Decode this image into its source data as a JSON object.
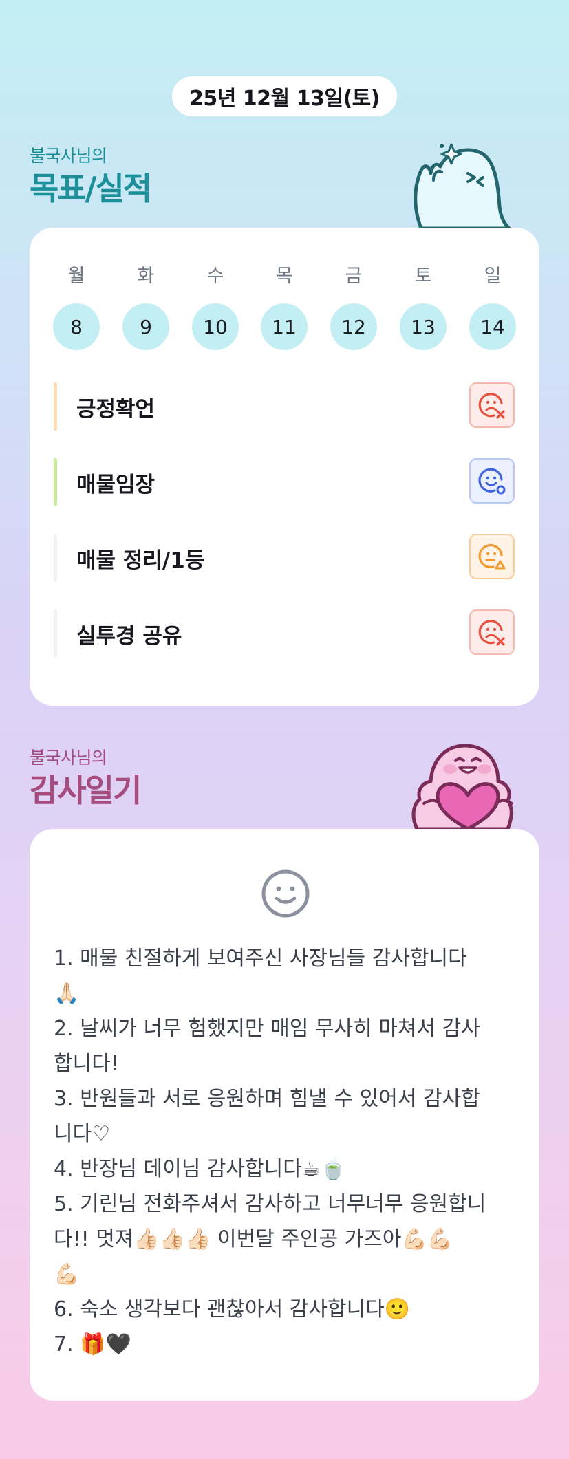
{
  "date": "25년 12월 13일(토)",
  "goals_section": {
    "subtitle": "불국사님의",
    "title": "목표/실적",
    "days": [
      {
        "name": "월",
        "date": "8"
      },
      {
        "name": "화",
        "date": "9"
      },
      {
        "name": "수",
        "date": "10"
      },
      {
        "name": "목",
        "date": "11"
      },
      {
        "name": "금",
        "date": "12"
      },
      {
        "name": "토",
        "date": "13"
      },
      {
        "name": "일",
        "date": "14"
      }
    ],
    "goals": [
      {
        "label": "긍정확언",
        "bar_color": "#f8dcae",
        "status": "sad-x-icon",
        "status_color": "#e8513f"
      },
      {
        "label": "매물임장",
        "bar_color": "#c7ec9a",
        "status": "smile-icon",
        "status_color": "#3e63dd"
      },
      {
        "label": "매물 정리/1등",
        "bar_color": "#f2f2f4",
        "status": "meh-warning-icon",
        "status_color": "#f39a2c"
      },
      {
        "label": "실투경 공유",
        "bar_color": "#f2f2f4",
        "status": "sad-x-icon",
        "status_color": "#e8513f"
      }
    ]
  },
  "diary_section": {
    "subtitle": "불국사님의",
    "title": "감사일기",
    "mood_icon": "smile-face-icon",
    "text": "1. 매물 친절하게 보여주신 사장님들 감사합니다\n🙏🏻\n2. 날씨가 너무 험했지만 매임 무사히 마쳐서 감사\n합니다!\n3. 반원들과 서로 응원하며 힘낼 수 있어서 감사합\n니다♡\n4. 반장님 데이님 감사합니다☕🍵\n5. 기린님 전화주셔서 감사하고 너무너무 응원합니\n다!! 멋져👍🏻👍🏻👍🏻 이번달 주인공 가즈아💪🏻💪🏻\n💪🏻\n6. 숙소 생각보다 괜찮아서 감사합니다🙂\n7. 🎁🖤"
  }
}
